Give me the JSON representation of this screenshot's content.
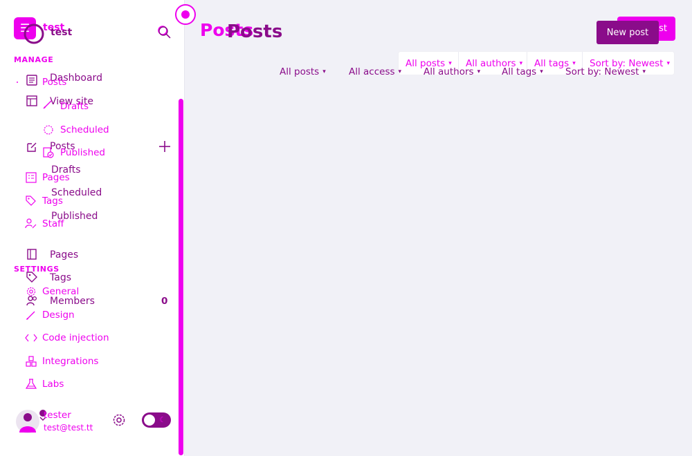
{
  "sidebar": {
    "site_title_pink": "test",
    "site_title_dark": "test",
    "manage_label": "MANAGE",
    "settings_label": "SETTINGS",
    "nav_dark": {
      "dashboard": "Dashboard",
      "view_site": "View site",
      "posts": "Posts",
      "drafts": "Drafts",
      "scheduled": "Scheduled",
      "published": "Published",
      "pages": "Pages",
      "tags": "Tags",
      "members": "Members",
      "members_count": "0"
    },
    "nav_pink": {
      "posts": "Posts",
      "drafts": "Drafts",
      "scheduled": "Scheduled",
      "published": "Published",
      "pages": "Pages",
      "tags": "Tags",
      "staff": "Staff",
      "general": "General",
      "design": "Design",
      "code_injection": "Code injection",
      "integrations": "Integrations",
      "labs": "Labs"
    },
    "user": {
      "name": "tester",
      "email": "test@test.tt"
    }
  },
  "main": {
    "title_pink": "Posts",
    "title_dark": "Posts",
    "new_post_pink": "New post",
    "new_post_dark": "New post",
    "filters_pink": {
      "all_posts": "All posts",
      "all_authors": "All authors",
      "all_tags": "All tags",
      "sort": "Sort by: Newest"
    },
    "filters_dark": {
      "all_posts": "All posts",
      "all_access": "All access",
      "all_authors": "All authors",
      "all_tags": "All tags",
      "sort": "Sort by: Newest"
    }
  },
  "icons": {
    "chevron": "▾",
    "moon": "☾"
  },
  "colors": {
    "accent_pink": "#ee00ee",
    "accent_dark": "#8a0c8a",
    "background": "#f1f1f7"
  }
}
